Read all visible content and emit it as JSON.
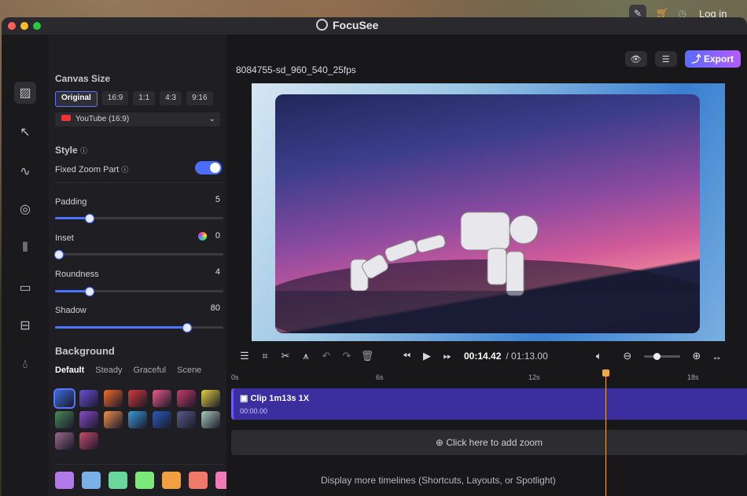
{
  "app": {
    "title": "FocuSee",
    "login_label": "Log in",
    "filename": "8084755-sd_960_540_25fps",
    "export_label": "Export"
  },
  "canvas_size": {
    "title": "Canvas Size",
    "ratios": [
      "Original",
      "16:9",
      "1:1",
      "4:3",
      "9:16"
    ],
    "selected_ratio": "Original",
    "preset_select": "YouTube (16:9)"
  },
  "style": {
    "title": "Style",
    "fixed_zoom_label": "Fixed Zoom Part",
    "fixed_zoom_on": true,
    "padding": {
      "label": "Padding",
      "value": "5",
      "fraction": 0.2
    },
    "inset": {
      "label": "Inset",
      "value": "0",
      "fraction": 0.02
    },
    "roundness": {
      "label": "Roundness",
      "value": "4",
      "fraction": 0.2
    },
    "shadow": {
      "label": "Shadow",
      "value": "80",
      "fraction": 0.78
    }
  },
  "background": {
    "title": "Background",
    "tabs": [
      "Default",
      "Steady",
      "Graceful",
      "Scene"
    ],
    "selected_tab": "Default",
    "wallpapers": [
      "#3a6ed8",
      "#6a4fd6",
      "#f06a2a",
      "#d83a3a",
      "#e85a8a",
      "#c83a6a",
      "#e0d040",
      "#4a8a5a",
      "#8a4ac8",
      "#f0904a",
      "#3a9ad8",
      "#2a5ab8",
      "#5a5a8a",
      "#a8c8b8",
      "#9a6a8a",
      "#c84a6a"
    ],
    "solid_colors": [
      "#b07ae8",
      "#7ab0e8",
      "#6ad89a",
      "#7ae87a",
      "#f0a040",
      "#f07a6a",
      "#f07ab8"
    ]
  },
  "toolbar": {
    "current_time": "00:14.42",
    "total_time": "/ 01:13.00"
  },
  "timeline": {
    "ruler_labels": [
      "0s",
      "6s",
      "12s",
      "18s"
    ],
    "clip_title": "Clip 1m13s  1X",
    "clip_time": "00:00.00",
    "add_zoom_label": "Click here to add zoom",
    "more_timelines_label": "Display more timelines (Shortcuts, Layouts, or Spotlight)"
  },
  "colors": {
    "accent": "#4d74ff",
    "playhead": "#f0a94a",
    "clip": "#3b2fa0"
  },
  "icons": [
    "canvas-icon",
    "cursor-icon",
    "motion-icon",
    "camera-icon",
    "audio-icon",
    "caption-icon",
    "layout-icon",
    "effects-icon"
  ]
}
